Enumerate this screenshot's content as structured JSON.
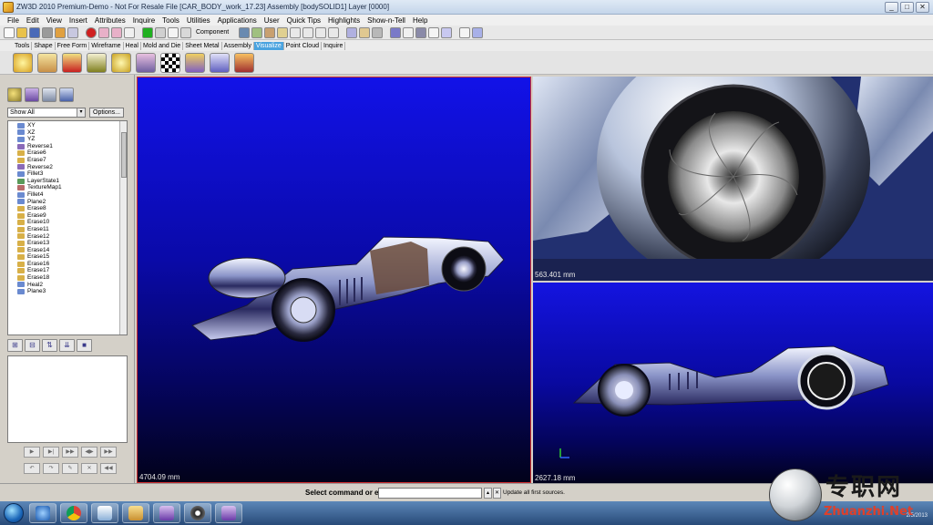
{
  "window": {
    "title": "ZW3D 2010 Premium-Demo - Not For Resale     File [CAR_BODY_work_17.23]  Assembly [bodySOLID1]  Layer [0000]",
    "controls": [
      "_",
      "□",
      "✕"
    ]
  },
  "menu": [
    "File",
    "Edit",
    "View",
    "Insert",
    "Attributes",
    "Inquire",
    "Tools",
    "Utilities",
    "Applications",
    "User",
    "Quick Tips",
    "Highlights",
    "Show-n-Tell",
    "Help"
  ],
  "toolbar": {
    "component_label": "Component"
  },
  "ribbon_tabs": [
    {
      "label": "Tools",
      "active": false
    },
    {
      "label": "Shape",
      "active": false
    },
    {
      "label": "Free Form",
      "active": false
    },
    {
      "label": "Wireframe",
      "active": false
    },
    {
      "label": "Heal",
      "active": false
    },
    {
      "label": "Mold and Die",
      "active": false
    },
    {
      "label": "Sheet Metal",
      "active": false
    },
    {
      "label": "Assembly",
      "active": false
    },
    {
      "label": "Visualize",
      "active": true
    },
    {
      "label": "Point Cloud",
      "active": false
    },
    {
      "label": "Inquire",
      "active": false
    }
  ],
  "left_panel": {
    "filter_value": "Show All",
    "options_label": "Options...",
    "history_items": [
      {
        "label": "XY",
        "icon": "plane-icon",
        "color": "#6a8ad0"
      },
      {
        "label": "XZ",
        "icon": "plane-icon",
        "color": "#6a8ad0"
      },
      {
        "label": "YZ",
        "icon": "plane-icon",
        "color": "#6a8ad0"
      },
      {
        "label": "Reverse1",
        "icon": "reverse-icon",
        "color": "#8a6ab8"
      },
      {
        "label": "Erase6",
        "icon": "erase-icon",
        "color": "#d8b048"
      },
      {
        "label": "Erase7",
        "icon": "erase-icon",
        "color": "#d8b048"
      },
      {
        "label": "Reverse2",
        "icon": "reverse-icon",
        "color": "#8a6ab8"
      },
      {
        "label": "Fillet3",
        "icon": "fillet-icon",
        "color": "#6a8ad0"
      },
      {
        "label": "LayerState1",
        "icon": "layer-icon",
        "color": "#5a9a5a"
      },
      {
        "label": "TextureMap1",
        "icon": "texture-icon",
        "color": "#b86a6a"
      },
      {
        "label": "Fillet4",
        "icon": "fillet-icon",
        "color": "#6a8ad0"
      },
      {
        "label": "Plane2",
        "icon": "plane-icon",
        "color": "#6a8ad0"
      },
      {
        "label": "Erase8",
        "icon": "erase-icon",
        "color": "#d8b048"
      },
      {
        "label": "Erase9",
        "icon": "erase-icon",
        "color": "#d8b048"
      },
      {
        "label": "Erase10",
        "icon": "erase-icon",
        "color": "#d8b048"
      },
      {
        "label": "Erase11",
        "icon": "erase-icon",
        "color": "#d8b048"
      },
      {
        "label": "Erase12",
        "icon": "erase-icon",
        "color": "#d8b048"
      },
      {
        "label": "Erase13",
        "icon": "erase-icon",
        "color": "#d8b048"
      },
      {
        "label": "Erase14",
        "icon": "erase-icon",
        "color": "#d8b048"
      },
      {
        "label": "Erase15",
        "icon": "erase-icon",
        "color": "#d8b048"
      },
      {
        "label": "Erase16",
        "icon": "erase-icon",
        "color": "#d8b048"
      },
      {
        "label": "Erase17",
        "icon": "erase-icon",
        "color": "#d8b048"
      },
      {
        "label": "Erase18",
        "icon": "erase-icon",
        "color": "#d8b048"
      },
      {
        "label": "Heal2",
        "icon": "heal-icon",
        "color": "#6a8ad0"
      },
      {
        "label": "Plane3",
        "icon": "plane-icon",
        "color": "#6a8ad0"
      }
    ],
    "play_row1": [
      "▶",
      "▶|",
      "▶▶",
      "◀▶",
      "▶▶"
    ],
    "play_row2": [
      "↶",
      "↷",
      "✎",
      "✕",
      "◀◀"
    ]
  },
  "viewports": {
    "left_scale": "4704.09 mm",
    "top_right_scale": "563.401 mm",
    "bottom_right_scale": "2627.18 mm"
  },
  "command_bar": {
    "prompt": "Select command or entity.",
    "input_value": "",
    "status": "Update all first sources."
  },
  "taskbar": {
    "apps": [
      "ie-icon",
      "chrome-icon",
      "media-icon",
      "folder-icon",
      "zw3d-icon",
      "obs-icon",
      "zw3d-icon"
    ],
    "date": "2/5/2013"
  },
  "watermark": {
    "chinese": "专职网",
    "url": "Zhuanzhi.Net"
  },
  "colors": {
    "viewport_blue": "#1212e8",
    "selected_tab": "#4aa3df",
    "viewport_border": "#d03030"
  }
}
